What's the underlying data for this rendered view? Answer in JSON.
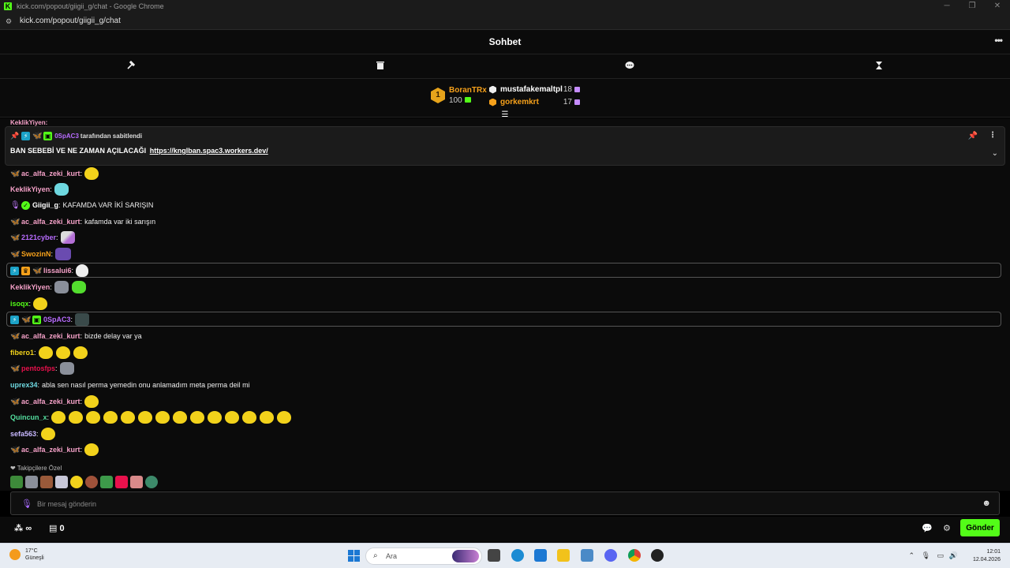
{
  "window": {
    "title": "kick.com/popout/giigii_g/chat - Google Chrome",
    "url": "kick.com/popout/giigii_g/chat"
  },
  "chat_header": {
    "title": "Sohbet"
  },
  "leaderboard": {
    "first": {
      "rank": "1",
      "name": "BoranTRx",
      "points": "100"
    },
    "others": [
      {
        "name": "mustafakemaltpl",
        "points": "18",
        "color": "#ffffff"
      },
      {
        "name": "gorkemkrt",
        "points": "17",
        "color": "#f6a11b"
      }
    ]
  },
  "stray_line": "KeklikYiyen:",
  "pinned": {
    "by_user": "0SpAC3",
    "by_suffix": "tarafından sabitlendi",
    "text": "BAN SEBEBİ VE NE ZAMAN AÇILACAĞI",
    "link": "https://knglban.spac3.workers.dev/"
  },
  "messages": [
    {
      "user": "ac_alfa_zeki_kurt",
      "text": ""
    },
    {
      "user": "KeklikYiyen",
      "text": ""
    },
    {
      "user": "Giigii_g",
      "text": "KAFAMDA VAR İKİ SARIŞIN"
    },
    {
      "user": "ac_alfa_zeki_kurt",
      "text": "kafamda var iki sarışın"
    },
    {
      "user": "2121cyber",
      "text": ""
    },
    {
      "user": "SwozinN",
      "text": ""
    },
    {
      "user": "lissalui6",
      "text": ""
    },
    {
      "user": "KeklikYiyen",
      "text": ""
    },
    {
      "user": "isoqx",
      "text": ""
    },
    {
      "user": "0SpAC3",
      "text": ""
    },
    {
      "user": "ac_alfa_zeki_kurt",
      "text": "bizde delay var ya"
    },
    {
      "user": "fibero1",
      "text": ""
    },
    {
      "user": "pentosfps",
      "text": ""
    },
    {
      "user": "uprex34",
      "text": "abla sen nasıl perma yemedin onu anlamadım meta perma deil mi"
    },
    {
      "user": "ac_alfa_zeki_kurt",
      "text": ""
    },
    {
      "user": "Quincun_x",
      "text": ""
    },
    {
      "user": "sefa563",
      "text": ""
    },
    {
      "user": "ac_alfa_zeki_kurt",
      "text": ""
    }
  ],
  "emote_tray": {
    "label": "Takipçilere Özel"
  },
  "input": {
    "placeholder": "Bir mesaj gönderin"
  },
  "footer": {
    "points": "∞",
    "store_count": "0",
    "send_label": "Gönder"
  },
  "taskbar": {
    "temp": "17°C",
    "weather": "Güneşli",
    "search_placeholder": "Ara",
    "time": "12:01",
    "date": "12.04.2026"
  },
  "colors": {
    "accent": "#53fc18",
    "pink_user": "#f6a2c9",
    "orange_user": "#f6a11b"
  }
}
